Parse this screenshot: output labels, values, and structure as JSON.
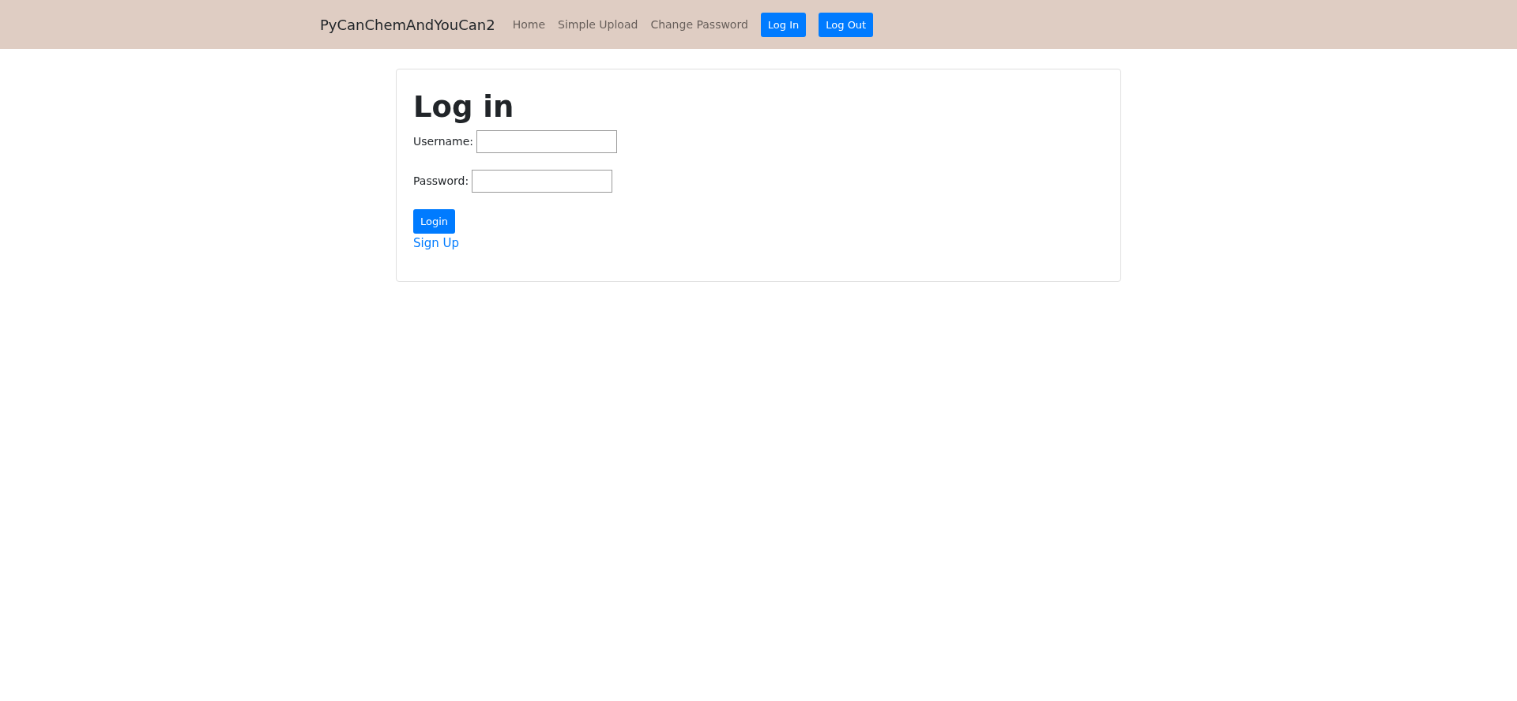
{
  "navbar": {
    "brand": "PyCanChemAndYouCan2",
    "links": [
      {
        "label": "Home",
        "kind": "link"
      },
      {
        "label": "Simple Upload",
        "kind": "link"
      },
      {
        "label": "Change Password",
        "kind": "link"
      },
      {
        "label": "Log In",
        "kind": "button"
      },
      {
        "label": "Log Out",
        "kind": "button"
      }
    ]
  },
  "card": {
    "title": "Log in",
    "fields": [
      {
        "label": "Username:"
      },
      {
        "label": "Password:"
      }
    ],
    "submit": "Login",
    "link": "Sign Up"
  }
}
